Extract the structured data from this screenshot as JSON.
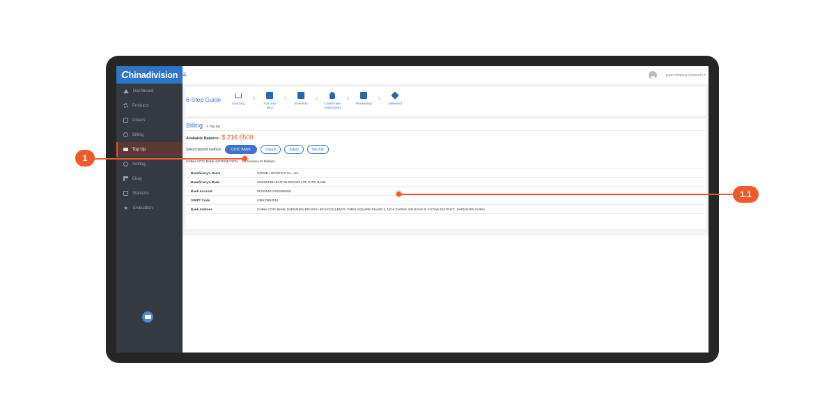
{
  "brand": {
    "logo_text": "hinadivision",
    "logo_mark": "C"
  },
  "sidebar": {
    "items": [
      {
        "label": "Dashboard",
        "icon": "house-icon"
      },
      {
        "label": "Products",
        "icon": "gear-icon"
      },
      {
        "label": "Orders",
        "icon": "document-icon"
      },
      {
        "label": "Billing",
        "icon": "dollar-icon"
      },
      {
        "label": "Top Up",
        "icon": "card-icon",
        "active": true
      },
      {
        "label": "Setting",
        "icon": "settings-icon"
      },
      {
        "label": "Ebay",
        "icon": "flag-icon"
      },
      {
        "label": "Statistics",
        "icon": "chart-icon"
      },
      {
        "label": "Evaluation",
        "icon": "star-icon"
      }
    ]
  },
  "topbar": {
    "menu_icon": "≡",
    "user_name": "guan zhiqiang (cnstorm) ▾"
  },
  "guide": {
    "title": "6-Step Guide",
    "steps": [
      {
        "label": "Sourcing",
        "icon": "cart-icon"
      },
      {
        "label": "Add new SKU",
        "icon": "sku-icon"
      },
      {
        "label": "Inventory",
        "icon": "inventory-icon"
      },
      {
        "label": "Create new ASN(Order)",
        "icon": "money-bag-icon"
      },
      {
        "label": "Processing",
        "icon": "processing-icon"
      },
      {
        "label": "Delivered",
        "icon": "box-icon"
      }
    ]
  },
  "billing": {
    "title": "Billing",
    "breadcrumb": "> Top Up",
    "balance_label": "Available Balance:",
    "balance_value": "$ 216.6500",
    "method_label": "Select deposit method:",
    "methods": [
      {
        "label": "CITIC BANK",
        "active": true
      },
      {
        "label": "Paypal",
        "active": false
      },
      {
        "label": "Alipay",
        "active": false
      },
      {
        "label": "Wechat",
        "active": false
      }
    ],
    "bank_info_title": "CHINA CITIC BANK INFORMATION",
    "bank_info_note": "(To receive US Dollars)",
    "rows": [
      {
        "key": "Beneficiary's Name",
        "value": "STONE LOGISTICS Co., Ltd."
      },
      {
        "key": "Beneficiary's Bank",
        "value": "SHENZHEN BAO'AN BRANCH OF CITIC BANK"
      },
      {
        "key": "Bank Account",
        "value": "8110314012400299459"
      },
      {
        "key": "SWIFT Code",
        "value": "CIBKCNBJ518"
      },
      {
        "key": "Bank Address",
        "value": "CHINA CITIC BANK,SHENZHEN BRANCH 8/F,EXCELLENCE TIMES SQUARE PHASE 2,  NO.6 ZHONG XIN ROAD 5,  FUTIAN DISTRICT ,SHENZHEN CHINA"
      }
    ]
  },
  "annotations": [
    {
      "label": "1"
    },
    {
      "label": "1.1"
    }
  ],
  "colors": {
    "accent": "#3b74c9",
    "annotation": "#f05a2a",
    "sidebar": "#353a40",
    "balance": "#e8542a"
  }
}
